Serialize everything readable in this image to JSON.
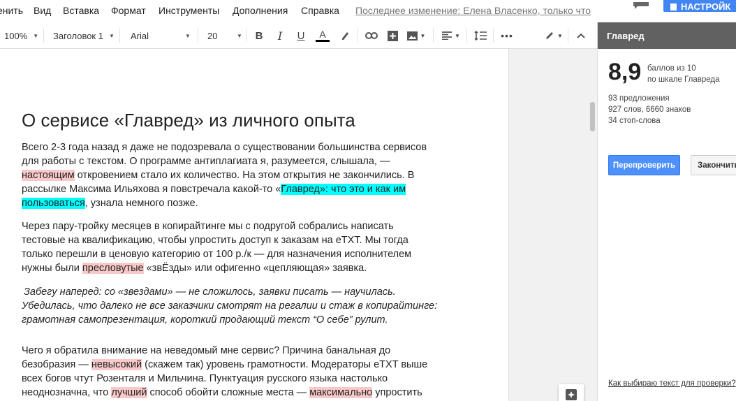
{
  "menu": {
    "items": [
      "енить",
      "Вид",
      "Вставка",
      "Формат",
      "Инструменты",
      "Дополнения",
      "Справка"
    ],
    "last_edit": "Последнее изменение: Елена Власенко, только что",
    "settings_label": "НАСТРОЙК"
  },
  "toolbar": {
    "zoom": "100%",
    "style": "Заголовок 1",
    "font": "Arial",
    "font_size": "20"
  },
  "document": {
    "title": "О сервисе «Главред» из личного опыта",
    "p1": {
      "l1": "Всего 2-3 года назад я даже не подозревала о существовании большинства сервисов",
      "l2": "для работы с текстом. О программе антиплагиата я, разумеется, слышала,  —",
      "l3_hl": "настоящим",
      "l3_rest": " откровением стало их количество. На этом открытия не закончились. В",
      "l4_pre": "рассылке Максима Ильяхова я повстречала какой-то «",
      "l4_hl": "Главред»: что это и как им",
      "l5_hl": "пользоваться",
      "l5_rest": ", узнала немного позже."
    },
    "p2": {
      "l1": "Через пару-тройку месяцев в копирайтинге мы с подругой собрались написать",
      "l2": "тестовые на квалификацию, чтобы упростить доступ к заказам на eTXT. Мы тогда",
      "l3": "только перешли в ценовую категорию от 100 р./к — для назначения исполнителем",
      "l4_pre": "нужны были ",
      "l4_hl": "пресловутые",
      "l4_rest": " «звЁзды» или офигенно «цепляющая» заявка."
    },
    "p3": {
      "l1": "Забегу наперед: со «звездами» — не сложилось, заявки писать — научилась.",
      "l2": "Убедилась, что далеко не все заказчики смотрят на регалии и стаж в копирайтинге:",
      "l3": "грамотная самопрезентация, короткий продающий текст “О себе” рулит."
    },
    "p4": {
      "l1": "Чего я обратила внимание на неведомый мне сервис? Причина банальная до",
      "l2_pre": "безобразия — ",
      "l2_hl": "невысокий",
      "l2_rest": " (скажем так) уровень грамотности. Модераторы eTXT выше",
      "l3": "всех богов чтут Розенталя и Мильчина. Пунктуация русского языка настолько",
      "l4_pre": "неоднозначна, что ",
      "l4_hl1": "лучший",
      "l4_mid": " способ обойти сложные места — ",
      "l4_hl2": "максимально",
      "l4_rest": " упростить"
    }
  },
  "panel": {
    "title": "Главред",
    "score": "8,9",
    "score_caption_1": "баллов из 10",
    "score_caption_2": "по шкале Главреда",
    "sentences": "93 предложения",
    "words": "927 слов, 6660 знаков",
    "stopwords": "34 стоп-слова",
    "recheck_label": "Перепроверить",
    "finish_label": "Закончить",
    "help_link": "Как выбираю текст для проверки?"
  },
  "colors": {
    "highlight_pink": "#f9c9c9",
    "highlight_cyan": "#00ffff",
    "accent_blue": "#4285f4",
    "panel_header": "#616161"
  }
}
